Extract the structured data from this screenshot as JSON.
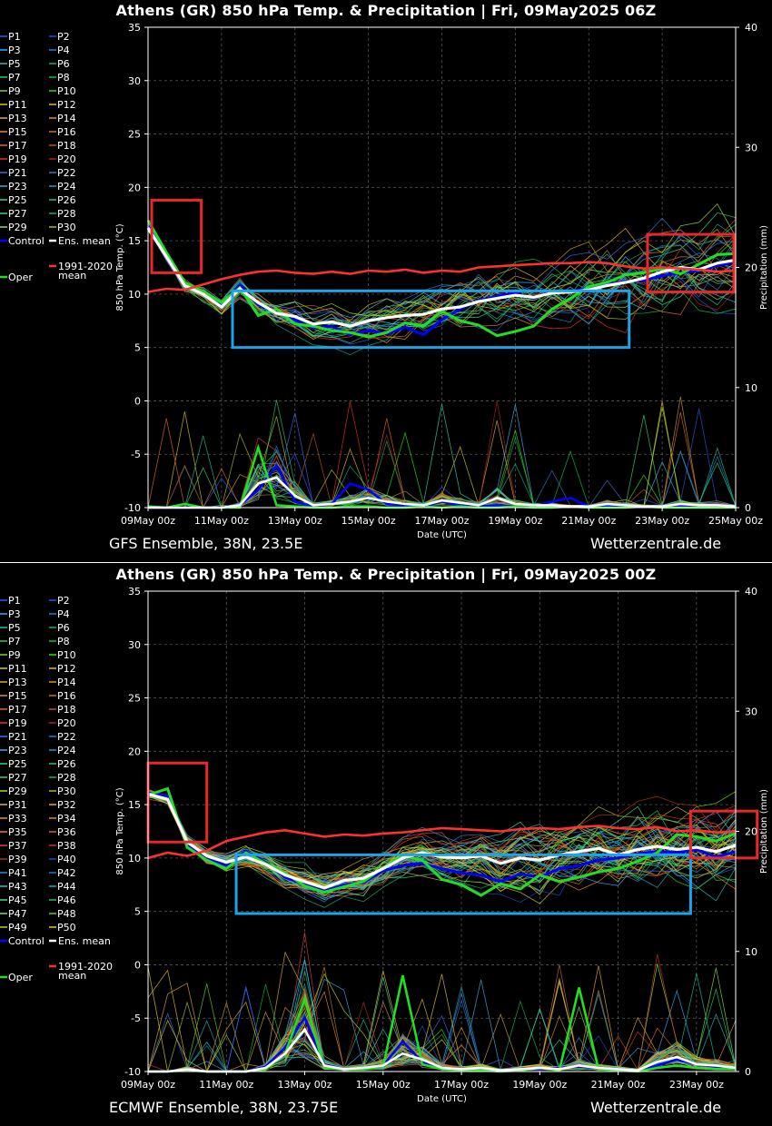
{
  "colors": {
    "background": "#000000",
    "axis": "#ffffff",
    "grid": "#555555",
    "control": "#0000ff",
    "ens_mean": "#ffffff",
    "climate_mean": "#ff3030",
    "oper": "#22dd22",
    "box_red": "#e8262b",
    "box_blue": "#1fa3e6"
  },
  "panels": [
    {
      "title": "Athens  (GR)  850 hPa Temp. & Precipitation | Fri, 09May2025 06Z",
      "model_label": "GFS Ensemble, 38N, 23.5E",
      "site_label": "Wetterzentrale.de",
      "members": [
        "P1",
        "P2",
        "P3",
        "P4",
        "P5",
        "P6",
        "P7",
        "P8",
        "P9",
        "P10",
        "P11",
        "P12",
        "P13",
        "P14",
        "P15",
        "P16",
        "P17",
        "P18",
        "P19",
        "P20",
        "P21",
        "P22",
        "P23",
        "P24",
        "P25",
        "P26",
        "P27",
        "P28",
        "P29",
        "P30"
      ],
      "legend_extra": [
        "Control",
        "Ens. mean",
        "1991-2020 mean",
        "Oper"
      ],
      "chart_data": {
        "type": "line",
        "xlabel": "Date (UTC)",
        "ylabel": "850 hPa Temp. (°C)",
        "y2label": "Precipitation (mm)",
        "x_ticks": [
          "09May 00z",
          "11May 00z",
          "13May 00z",
          "15May 00z",
          "17May 00z",
          "19May 00z",
          "21May 00z",
          "23May 00z",
          "25May 00z"
        ],
        "xlim_days": [
          0,
          16
        ],
        "ylim": [
          -10,
          35
        ],
        "y_ticks": [
          -10,
          -5,
          0,
          5,
          10,
          15,
          20,
          25,
          30,
          35
        ],
        "y2lim": [
          0,
          40
        ],
        "y2_ticks": [
          0,
          10,
          20,
          30,
          40
        ],
        "grid": true,
        "days": [
          0,
          0.5,
          1,
          1.5,
          2,
          2.5,
          3,
          3.5,
          4,
          4.5,
          5,
          5.5,
          6,
          6.5,
          7,
          7.5,
          8,
          8.5,
          9,
          9.5,
          10,
          10.5,
          11,
          11.5,
          12,
          12.5,
          13,
          13.5,
          14,
          14.5,
          15,
          15.5,
          16
        ],
        "series": [
          {
            "name": "Ens. mean",
            "values": [
              16.2,
              13.5,
              10.8,
              10.0,
              8.8,
              10.5,
              9.2,
              8.2,
              7.9,
              7.2,
              7.4,
              7.0,
              7.5,
              7.8,
              8.0,
              8.1,
              8.6,
              8.8,
              9.3,
              9.6,
              9.9,
              9.7,
              10.1,
              10.2,
              10.4,
              10.8,
              11.1,
              11.5,
              12.1,
              12.5,
              12.3,
              12.9,
              13.2
            ]
          },
          {
            "name": "Control",
            "values": [
              16.6,
              13.8,
              11.0,
              10.1,
              8.9,
              10.9,
              9.0,
              8.3,
              7.6,
              6.8,
              7.0,
              6.2,
              6.6,
              6.3,
              6.9,
              6.2,
              7.6,
              8.6,
              9.4,
              9.8,
              10.1,
              9.6,
              10.3,
              10.2,
              10.6,
              10.9,
              11.2,
              11.3,
              11.7,
              12.0,
              12.2,
              12.7,
              13.0
            ]
          },
          {
            "name": "Oper",
            "values": [
              16.9,
              13.9,
              11.1,
              10.2,
              9.2,
              10.6,
              8.0,
              8.6,
              7.2,
              7.0,
              6.6,
              6.4,
              6.0,
              6.4,
              7.3,
              7.0,
              8.4,
              7.5,
              7.1,
              6.1,
              6.5,
              7.0,
              8.6,
              9.6,
              10.7,
              11.1,
              11.8,
              12.0,
              12.4,
              11.9,
              12.8,
              13.7,
              13.8
            ]
          },
          {
            "name": "1991-2020 mean",
            "values": [
              10.2,
              10.5,
              10.4,
              10.9,
              11.4,
              11.8,
              12.1,
              12.2,
              12.0,
              11.9,
              12.1,
              11.9,
              12.2,
              12.1,
              12.3,
              12.0,
              12.2,
              12.1,
              12.5,
              12.6,
              12.7,
              12.8,
              12.9,
              12.9,
              13.0,
              12.9,
              12.6,
              12.4,
              12.5,
              12.4,
              12.3,
              12.1,
              12.2
            ]
          }
        ],
        "precip_mean": [
          0,
          0,
          0,
          0,
          0,
          0.2,
          2,
          2.5,
          1,
          0.2,
          0.3,
          0.5,
          0.8,
          0.5,
          0.3,
          0.2,
          0.6,
          0.4,
          0.2,
          0.8,
          0.3,
          0.2,
          0.2,
          0.1,
          0.1,
          0.3,
          0.2,
          0.1,
          0.1,
          0.3,
          0.2,
          0.2,
          0.1
        ],
        "precip_control": [
          0,
          0,
          0,
          0,
          0,
          0.2,
          1.5,
          3.5,
          0.5,
          0.1,
          0.3,
          2,
          1.5,
          0.3,
          0.2,
          0.1,
          0.5,
          0.2,
          0.1,
          0.2,
          0.1,
          0.1,
          0.5,
          0.8,
          0.1,
          0.1,
          0.1,
          0.1,
          0.1,
          0.1,
          0.1,
          0.1,
          0.1
        ],
        "precip_oper": [
          0.1,
          0,
          0.3,
          0,
          0,
          0,
          5,
          0.2,
          0.1,
          0,
          0,
          0.1,
          0.1,
          0,
          0,
          0.1,
          0,
          0.1,
          0,
          0,
          0.1,
          0,
          0,
          0.1,
          0,
          0,
          0,
          0.1,
          0,
          0,
          0,
          0,
          0
        ],
        "annotations": [
          {
            "color": "red",
            "x": [
              0.1,
              1.45
            ],
            "y": [
              12.0,
              18.8
            ]
          },
          {
            "color": "blue",
            "x": [
              2.3,
              13.1
            ],
            "y": [
              5.0,
              10.3
            ]
          },
          {
            "color": "red",
            "x": [
              13.6,
              15.95
            ],
            "y": [
              10.2,
              15.6
            ]
          }
        ]
      }
    },
    {
      "title": "Athens  (GR)  850 hPa Temp. & Precipitation | Fri, 09May2025 00Z",
      "model_label": "ECMWF Ensemble, 38N, 23.75E",
      "site_label": "Wetterzentrale.de",
      "members": [
        "P1",
        "P2",
        "P3",
        "P4",
        "P5",
        "P6",
        "P7",
        "P8",
        "P9",
        "P10",
        "P11",
        "P12",
        "P13",
        "P14",
        "P15",
        "P16",
        "P17",
        "P18",
        "P19",
        "P20",
        "P21",
        "P22",
        "P23",
        "P24",
        "P25",
        "P26",
        "P27",
        "P28",
        "P29",
        "P30",
        "P31",
        "P32",
        "P33",
        "P34",
        "P35",
        "P36",
        "P37",
        "P38",
        "P39",
        "P40",
        "P41",
        "P42",
        "P43",
        "P44",
        "P45",
        "P46",
        "P47",
        "P48",
        "P49",
        "P50"
      ],
      "legend_extra": [
        "Control",
        "Ens. mean",
        "1991-2020 mean",
        "Oper"
      ],
      "chart_data": {
        "type": "line",
        "xlabel": "Date (UTC)",
        "ylabel": "850 hPa Temp. (°C)",
        "y2label": "Precipitation (mm)",
        "x_ticks": [
          "09May 00z",
          "11May 00z",
          "13May 00z",
          "15May 00z",
          "17May 00z",
          "19May 00z",
          "21May 00z",
          "23May 00z"
        ],
        "xlim_days": [
          0,
          15
        ],
        "ylim": [
          -10,
          35
        ],
        "y_ticks": [
          -10,
          -5,
          0,
          5,
          10,
          15,
          20,
          25,
          30,
          35
        ],
        "y2lim": [
          0,
          40
        ],
        "y2_ticks": [
          0,
          10,
          20,
          30,
          40
        ],
        "grid": true,
        "days": [
          0,
          0.5,
          1,
          1.5,
          2,
          2.5,
          3,
          3.5,
          4,
          4.5,
          5,
          5.5,
          6,
          6.5,
          7,
          7.5,
          8,
          8.5,
          9,
          9.5,
          10,
          10.5,
          11,
          11.5,
          12,
          12.5,
          13,
          13.5,
          14,
          14.5,
          15
        ],
        "series": [
          {
            "name": "Ens. mean",
            "values": [
              16.0,
              15.5,
              11.5,
              10.2,
              9.6,
              10.1,
              9.4,
              8.4,
              7.8,
              7.2,
              7.9,
              8.1,
              9.0,
              10.0,
              10.5,
              10.1,
              10.0,
              10.2,
              9.5,
              10.0,
              9.8,
              10.3,
              10.6,
              10.9,
              10.3,
              10.8,
              11.1,
              10.8,
              11.0,
              10.6,
              11.2
            ]
          },
          {
            "name": "Control",
            "values": [
              16.1,
              15.8,
              11.3,
              9.9,
              9.3,
              10.6,
              9.6,
              8.2,
              7.5,
              6.9,
              7.5,
              7.7,
              8.8,
              9.3,
              9.5,
              9.0,
              8.6,
              8.4,
              7.8,
              8.5,
              8.2,
              9.0,
              9.3,
              9.8,
              10.0,
              10.4,
              10.6,
              10.5,
              10.8,
              10.1,
              10.6
            ]
          },
          {
            "name": "Oper",
            "values": [
              15.9,
              16.5,
              11.0,
              9.8,
              9.0,
              10.5,
              9.5,
              8.6,
              7.4,
              6.8,
              7.3,
              7.8,
              9.1,
              10.2,
              9.8,
              8.0,
              7.5,
              6.5,
              7.6,
              7.1,
              8.4,
              7.8,
              8.2,
              8.7,
              9.0,
              9.7,
              10.5,
              12.2,
              12.0,
              11.6,
              12.3
            ]
          },
          {
            "name": "1991-2020 mean",
            "values": [
              10.0,
              10.5,
              10.2,
              10.7,
              11.6,
              12.0,
              12.4,
              12.6,
              12.3,
              12.0,
              12.2,
              12.1,
              12.3,
              12.4,
              12.6,
              12.8,
              12.7,
              12.6,
              12.5,
              12.7,
              12.8,
              12.7,
              12.9,
              13.0,
              12.8,
              12.7,
              12.9,
              12.5,
              12.6,
              12.4,
              12.5
            ]
          }
        ],
        "precip_mean": [
          0,
          0,
          0.2,
          0,
          0,
          0,
          0.3,
          1.5,
          3.5,
          0.5,
          0.2,
          0.3,
          0.5,
          1.5,
          1.0,
          0.3,
          0.2,
          0.3,
          0.1,
          0.2,
          0.3,
          0.2,
          0.5,
          0.3,
          0.2,
          0.1,
          0.8,
          1.2,
          0.6,
          0.5,
          0.3
        ],
        "precip_control": [
          0,
          0,
          0.2,
          0,
          0,
          0,
          0.4,
          2,
          4.5,
          0.6,
          0.2,
          0.3,
          0.5,
          2.5,
          0.8,
          0.2,
          0.1,
          0.2,
          0.1,
          0.2,
          0.2,
          0.3,
          0.4,
          0.3,
          0.2,
          0.1,
          0.5,
          1.0,
          0.6,
          0.4,
          0.3
        ],
        "precip_oper": [
          0,
          0,
          0.1,
          0,
          0,
          0,
          0.2,
          1.5,
          6,
          0.3,
          0.2,
          0.2,
          0.4,
          8,
          0.6,
          0.2,
          0.1,
          0.1,
          0,
          0.1,
          0.3,
          0.1,
          7,
          0.2,
          0.1,
          0,
          0.3,
          0.5,
          0.3,
          0.2,
          0.2
        ],
        "annotations": [
          {
            "color": "red",
            "x": [
              0.0,
              1.5
            ],
            "y": [
              11.5,
              18.9
            ]
          },
          {
            "color": "blue",
            "x": [
              2.25,
              13.85
            ],
            "y": [
              4.8,
              10.3
            ]
          },
          {
            "color": "red",
            "x": [
              13.85,
              15.55
            ],
            "y": [
              10.0,
              14.4
            ]
          }
        ]
      }
    }
  ]
}
